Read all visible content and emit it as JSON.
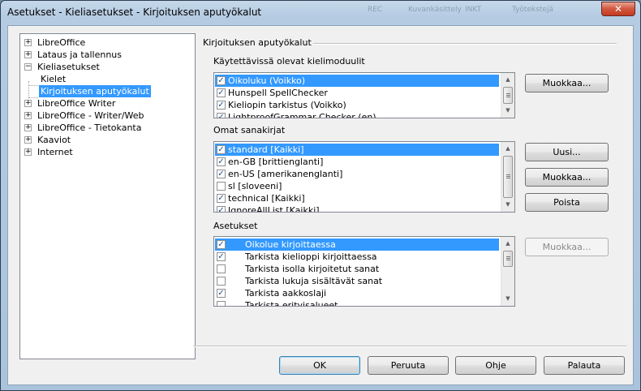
{
  "window": {
    "title": "Asetukset - Kieliasetukset - Kirjoituksen aputyökalut",
    "close_glyph": "✕",
    "background_taskbar": [
      "REC",
      "Kuvankäsittely",
      "INKT",
      "Työtekstejä"
    ]
  },
  "tree": {
    "items": [
      {
        "label": "LibreOffice",
        "expander": "+"
      },
      {
        "label": "Lataus ja tallennus",
        "expander": "+"
      },
      {
        "label": "Kieliasetukset",
        "expander": "−"
      },
      {
        "label": "Kielet"
      },
      {
        "label": "Kirjoituksen aputyökalut",
        "selected": true
      },
      {
        "label": "LibreOffice Writer",
        "expander": "+"
      },
      {
        "label": "LibreOffice - Writer/Web",
        "expander": "+"
      },
      {
        "label": "LibreOffice - Tietokanta",
        "expander": "+"
      },
      {
        "label": "Kaaviot",
        "expander": "+"
      },
      {
        "label": "Internet",
        "expander": "+"
      }
    ]
  },
  "main": {
    "group_title": "Kirjoituksen aputyökalut",
    "modules": {
      "label": "Käytettävissä olevat kielimoduulit",
      "items": [
        {
          "label": "Oikoluku (Voikko)",
          "checked": true,
          "selected": true
        },
        {
          "label": "Hunspell SpellChecker",
          "checked": true
        },
        {
          "label": "Kieliopin tarkistus (Voikko)",
          "checked": true
        },
        {
          "label": "LightproofGrammar Checker (en)",
          "checked": true
        }
      ],
      "edit_button": "Muokkaa..."
    },
    "dictionaries": {
      "label": "Omat sanakirjat",
      "items": [
        {
          "label": "standard [Kaikki]",
          "checked": true,
          "selected": true
        },
        {
          "label": "en-GB [brittienglanti]",
          "checked": true
        },
        {
          "label": "en-US [amerikanenglanti]",
          "checked": true
        },
        {
          "label": "sl [sloveeni]",
          "checked": false
        },
        {
          "label": "technical [Kaikki]",
          "checked": true
        },
        {
          "label": "IgnoreAllList [Kaikki]",
          "checked": true
        }
      ],
      "new_button": "Uusi...",
      "edit_button": "Muokkaa...",
      "delete_button": "Poista"
    },
    "settings": {
      "label": "Asetukset",
      "items": [
        {
          "label": "Oikolue kirjoittaessa",
          "checked": true,
          "selected": true
        },
        {
          "label": "Tarkista kielioppi kirjoittaessa",
          "checked": true
        },
        {
          "label": "Tarkista isolla kirjoitetut sanat",
          "checked": false
        },
        {
          "label": "Tarkista lukuja sisältävät sanat",
          "checked": false
        },
        {
          "label": "Tarkista aakkoslaji",
          "checked": true
        },
        {
          "label": "Tarkista erityisalueet",
          "checked": false
        }
      ],
      "edit_button": "Muokkaa..."
    }
  },
  "footer": {
    "ok": "OK",
    "cancel": "Peruuta",
    "help": "Ohje",
    "reset": "Palauta"
  },
  "check_glyph": "✓"
}
